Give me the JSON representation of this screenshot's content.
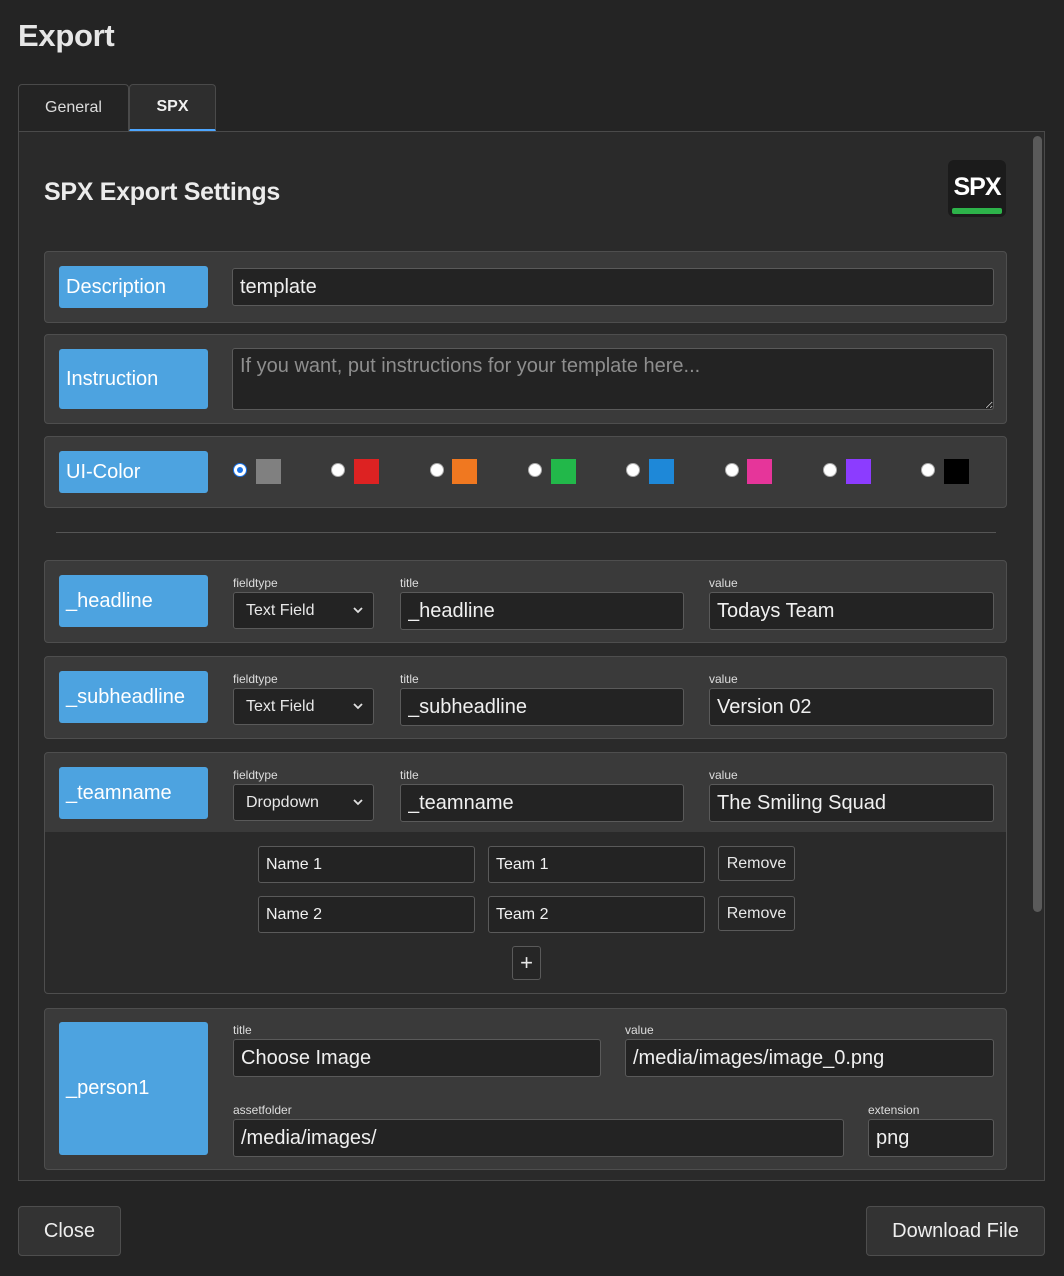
{
  "dialog": {
    "title": "Export"
  },
  "tabs": [
    {
      "label": "General",
      "active": false
    },
    {
      "label": "SPX",
      "active": true
    }
  ],
  "spx": {
    "heading": "SPX Export Settings",
    "logo_text": "SPX",
    "description": {
      "label": "Description",
      "value": "template"
    },
    "instruction": {
      "label": "Instruction",
      "value": "",
      "placeholder": "If you want, put instructions for your template here..."
    },
    "ui_color": {
      "label": "UI-Color",
      "selected": "gray",
      "options": [
        {
          "name": "gray",
          "hex": "#808080"
        },
        {
          "name": "red",
          "hex": "#dd2222"
        },
        {
          "name": "orange",
          "hex": "#f07820"
        },
        {
          "name": "green",
          "hex": "#22b84a"
        },
        {
          "name": "blue",
          "hex": "#1e88d8"
        },
        {
          "name": "pink",
          "hex": "#e6359a"
        },
        {
          "name": "purple",
          "hex": "#8c3cff"
        },
        {
          "name": "black",
          "hex": "#000000"
        }
      ]
    },
    "field_labels": {
      "fieldtype": "fieldtype",
      "title": "title",
      "value": "value",
      "assetfolder": "assetfolder",
      "extension": "extension"
    },
    "fields": [
      {
        "name": "_headline",
        "fieldtype": "Text Field",
        "title": "_headline",
        "value": "Todays Team"
      },
      {
        "name": "_subheadline",
        "fieldtype": "Text Field",
        "title": "_subheadline",
        "value": "Version 02"
      },
      {
        "name": "_teamname",
        "fieldtype": "Dropdown",
        "title": "_teamname",
        "value": "The Smiling Squad",
        "options": [
          {
            "text": "Name 1",
            "value": "Team 1",
            "remove_label": "Remove"
          },
          {
            "text": "Name 2",
            "value": "Team 2",
            "remove_label": "Remove"
          }
        ],
        "add_label": "+"
      }
    ],
    "image_field": {
      "name": "_person1",
      "title": "Choose Image",
      "value": "/media/images/image_0.png",
      "assetfolder": "/media/images/",
      "extension": "png"
    }
  },
  "footer": {
    "close_label": "Close",
    "download_label": "Download File"
  },
  "colors": {
    "accent": "#4da3e0",
    "background": "#242424",
    "panel": "#3a3a3a"
  }
}
